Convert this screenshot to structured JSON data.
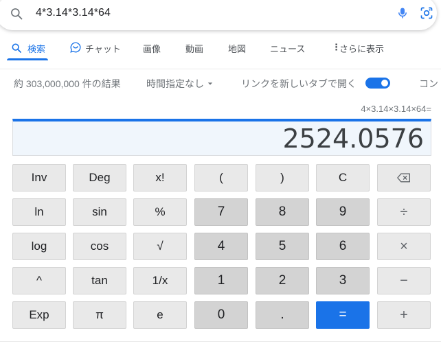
{
  "search": {
    "query": "4*3.14*3.14*64"
  },
  "tabs": [
    {
      "label": "検索"
    },
    {
      "label": "チャット"
    },
    {
      "label": "画像"
    },
    {
      "label": "動画"
    },
    {
      "label": "地図"
    },
    {
      "label": "ニュース"
    },
    {
      "label": "さらに表示"
    }
  ],
  "info": {
    "result_count": "約 303,000,000 件の結果",
    "time_filter": "時間指定なし",
    "new_tab_label": "リンクを新しいタブで開く",
    "more_label": "コン"
  },
  "calculator": {
    "expression": "4×3.14×3.14×64=",
    "result": "2524.0576",
    "keys": [
      [
        "Inv",
        "Deg",
        "x!",
        "(",
        ")",
        "C",
        ""
      ],
      [
        "ln",
        "sin",
        "%",
        "7",
        "8",
        "9",
        "÷"
      ],
      [
        "log",
        "cos",
        "√",
        "4",
        "5",
        "6",
        "×"
      ],
      [
        "^",
        "tan",
        "1/x",
        "1",
        "2",
        "3",
        "−"
      ],
      [
        "Exp",
        "π",
        "e",
        "0",
        ".",
        "=",
        "+"
      ]
    ]
  },
  "colors": {
    "accent": "#1a73e8",
    "num_key": "#d3d3d3",
    "fn_key": "#e9e9e9"
  }
}
